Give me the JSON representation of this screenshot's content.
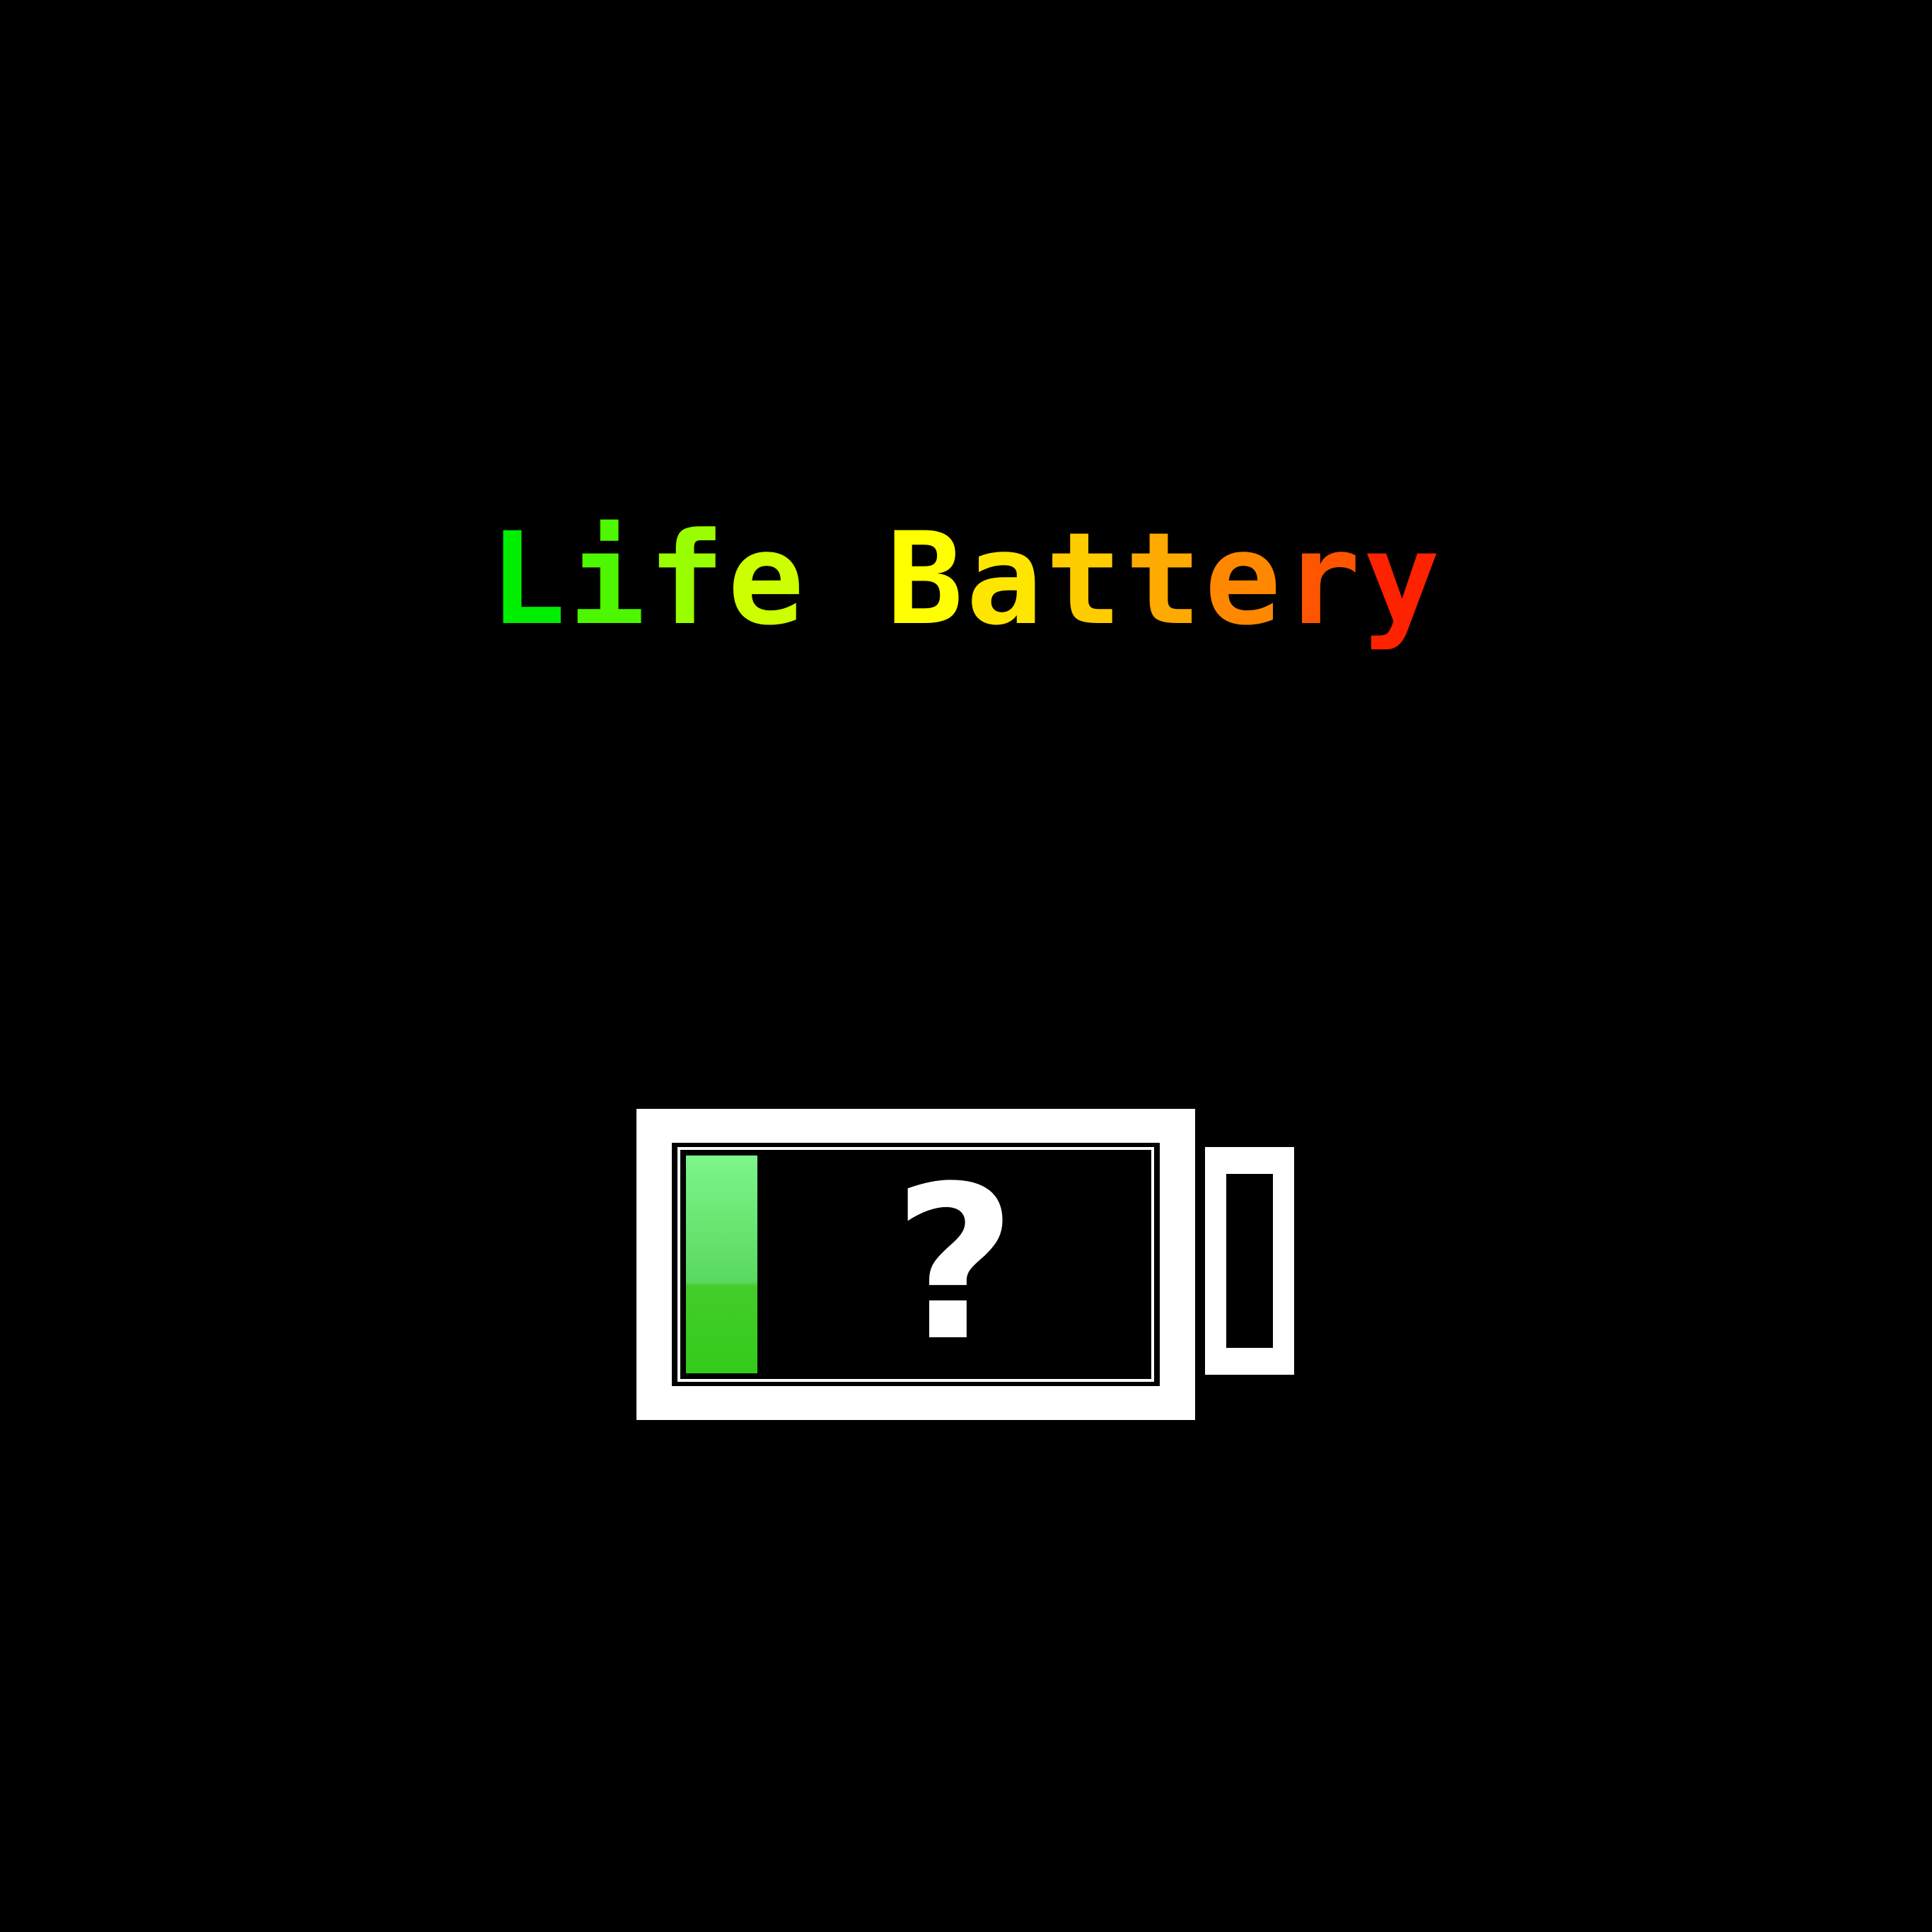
{
  "title": {
    "text": "Life Battery",
    "gradient_colors": [
      "#00ee00",
      "#99ff00",
      "#ffff00",
      "#ffcc00",
      "#ff8800",
      "#ff2200"
    ]
  },
  "battery": {
    "level": 0.2,
    "status_symbol": "?",
    "fill_colors": [
      "#7df58a",
      "#33cc1a"
    ],
    "outline_color": "#ffffff",
    "icon": "battery-icon"
  }
}
